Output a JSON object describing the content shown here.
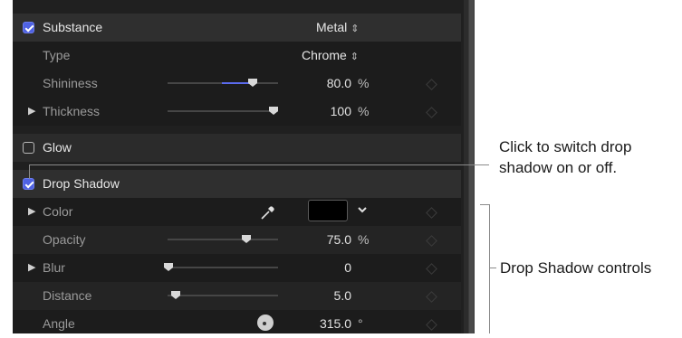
{
  "inspector": {
    "substance": {
      "label": "Substance",
      "value": "Metal",
      "checked": true
    },
    "type": {
      "label": "Type",
      "value": "Chrome"
    },
    "shininess": {
      "label": "Shininess",
      "value": "80.0",
      "unit": "%",
      "slider_level": 0.8
    },
    "thickness": {
      "label": "Thickness",
      "value": "100",
      "unit": "%",
      "slider_level": 1.0
    },
    "glow": {
      "label": "Glow",
      "checked": false
    },
    "drop_shadow": {
      "label": "Drop Shadow",
      "checked": true
    },
    "color": {
      "label": "Color",
      "swatch_color": "#000000"
    },
    "opacity": {
      "label": "Opacity",
      "value": "75.0",
      "unit": "%",
      "slider_level": 0.75
    },
    "blur": {
      "label": "Blur",
      "value": "0",
      "slider_level": 0.0
    },
    "distance": {
      "label": "Distance",
      "value": "5.0",
      "slider_level": 0.05
    },
    "angle": {
      "label": "Angle",
      "value": "315.0",
      "unit": "°"
    }
  },
  "callouts": {
    "toggle_line1": "Click to switch drop",
    "toggle_line2": "shadow on or off.",
    "controls": "Drop Shadow controls"
  },
  "colors": {
    "accent": "#5b6bee",
    "panel_bg": "#202020"
  }
}
